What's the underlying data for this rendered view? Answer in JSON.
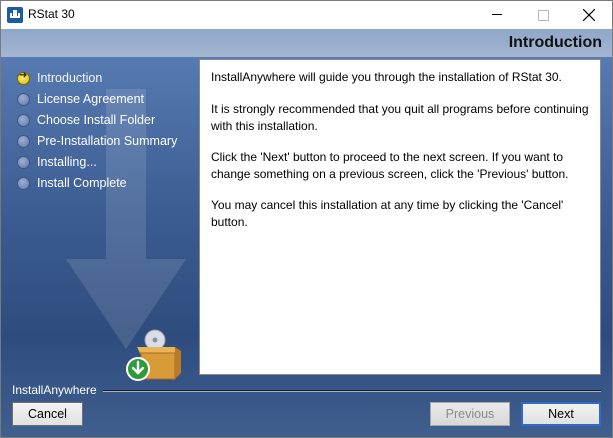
{
  "window": {
    "title": "RStat 30"
  },
  "header": {
    "title": "Introduction"
  },
  "steps": [
    {
      "label": "Introduction",
      "active": true
    },
    {
      "label": "License Agreement",
      "active": false
    },
    {
      "label": "Choose Install Folder",
      "active": false
    },
    {
      "label": "Pre-Installation Summary",
      "active": false
    },
    {
      "label": "Installing...",
      "active": false
    },
    {
      "label": "Install Complete",
      "active": false
    }
  ],
  "panel": {
    "paragraphs": [
      "InstallAnywhere will guide you through the installation of RStat 30.",
      "It is strongly recommended that you quit all programs before continuing with this installation.",
      "Click the 'Next' button to proceed to the next screen. If you want to change something on a previous screen, click the 'Previous' button.",
      "You may cancel this installation at any time by clicking the 'Cancel' button."
    ]
  },
  "footer": {
    "brand": "InstallAnywhere",
    "cancel_label": "Cancel",
    "previous_label": "Previous",
    "next_label": "Next"
  },
  "colors": {
    "accent": "#2f6cc7",
    "sidebar": "#4a6da3",
    "active_step": "#f0d21a"
  }
}
